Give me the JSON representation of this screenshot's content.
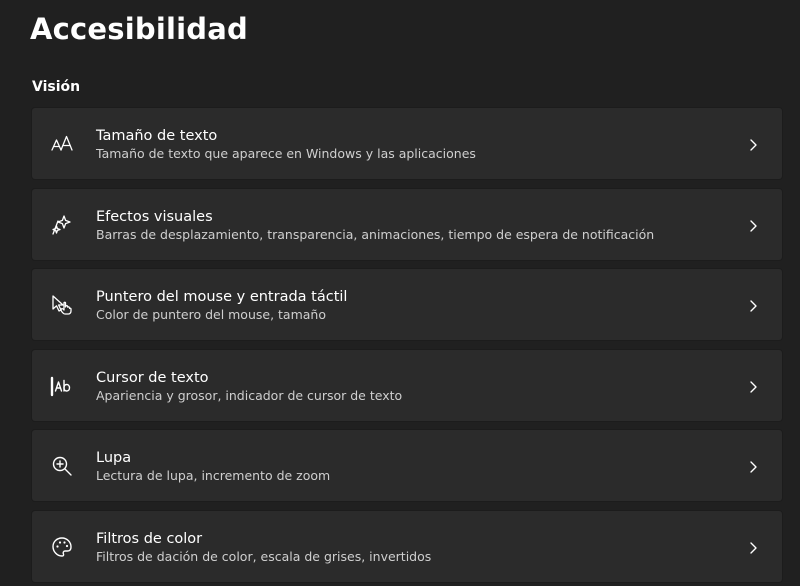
{
  "header": {
    "title": "Accesibilidad"
  },
  "section": {
    "title": "Visión"
  },
  "items": [
    {
      "icon": "text-size-icon",
      "label": "Tamaño de texto",
      "description": "Tamaño de texto que aparece en Windows y las aplicaciones"
    },
    {
      "icon": "sparkle-icon",
      "label": "Efectos visuales",
      "description": "Barras de desplazamiento, transparencia, animaciones, tiempo de espera de notificación"
    },
    {
      "icon": "mouse-pointer-touch-icon",
      "label": "Puntero del mouse y entrada táctil",
      "description": "Color de puntero del mouse, tamaño"
    },
    {
      "icon": "text-cursor-icon",
      "label": "Cursor de texto",
      "description": "Apariencia y grosor, indicador de cursor de texto"
    },
    {
      "icon": "magnifier-icon",
      "label": "Lupa",
      "description": "Lectura de lupa, incremento de zoom"
    },
    {
      "icon": "palette-icon",
      "label": "Filtros de color",
      "description": "Filtros de dación de color, escala de grises, invertidos"
    }
  ],
  "colors": {
    "background": "#202020",
    "card": "#2b2b2b",
    "text": "#ffffff",
    "secondary_text": "#cfcfcf"
  }
}
